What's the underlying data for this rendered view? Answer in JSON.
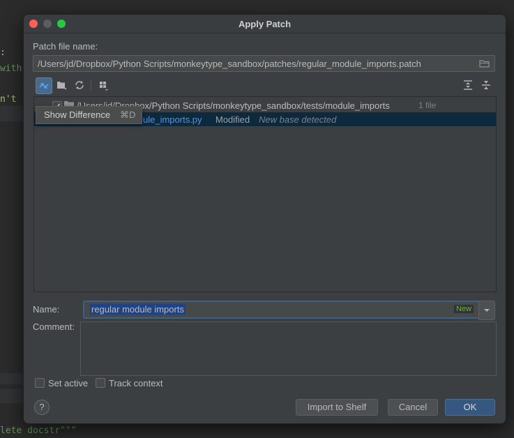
{
  "background": {
    "code_lines": [
      ":",
      "with",
      "n't",
      "lete docstr\"\"\""
    ]
  },
  "dialog": {
    "title": "Apply Patch",
    "patch_label": "Patch file name:",
    "patch_path": "/Users/jd/Dropbox/Python Scripts/monkeytype_sandbox/patches/regular_module_imports.patch",
    "toolbar": {
      "show_diff_icon": "show-difference-icon",
      "move_to_changelist_icon": "changelist-icon",
      "refresh_icon": "refresh-icon",
      "group_by_icon": "group-by-icon",
      "expand_all_icon": "expand-all-icon",
      "collapse_all_icon": "collapse-all-icon"
    },
    "tooltip": {
      "text": "Show Difference",
      "shortcut": "⌘D"
    },
    "tree": {
      "folder": {
        "path": "/Users/jd/Dropbox/Python Scripts/monkeytype_sandbox/tests/module_imports",
        "count": "1 file",
        "checked": true
      },
      "file": {
        "name": "ule_imports.py",
        "status": "Modified",
        "note": "New base detected",
        "checked": true
      }
    },
    "name_label": "Name:",
    "name_value": "regular module imports",
    "name_badge": "New",
    "comment_label": "Comment:",
    "comment_value": "",
    "set_active_label": "Set active",
    "track_context_label": "Track context",
    "buttons": {
      "help": "?",
      "import_to_shelf": "Import to Shelf",
      "cancel": "Cancel",
      "ok": "OK"
    }
  },
  "colors": {
    "accent": "#365880",
    "selection": "#0d293e",
    "file_name": "#5394ec",
    "badge_text": "#62b543"
  }
}
